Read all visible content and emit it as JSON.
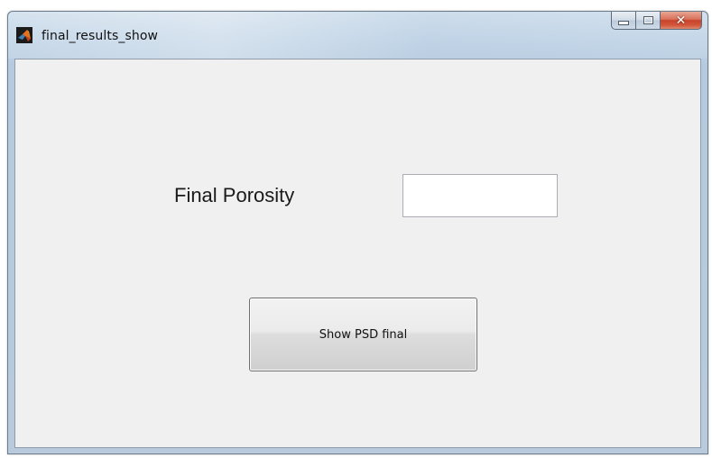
{
  "window": {
    "title": "final_results_show",
    "icon": "matlab-icon",
    "caption_buttons": {
      "minimize": "minimize-icon",
      "maximize": "maximize-icon",
      "close": "close-icon"
    }
  },
  "form": {
    "porosity_label": "Final Porosity",
    "porosity_value": "",
    "show_psd_button": "Show PSD final"
  },
  "colors": {
    "client_background": "#f0f0f0",
    "titlebar": "#bfd3e6",
    "close_button": "#c7432a"
  }
}
